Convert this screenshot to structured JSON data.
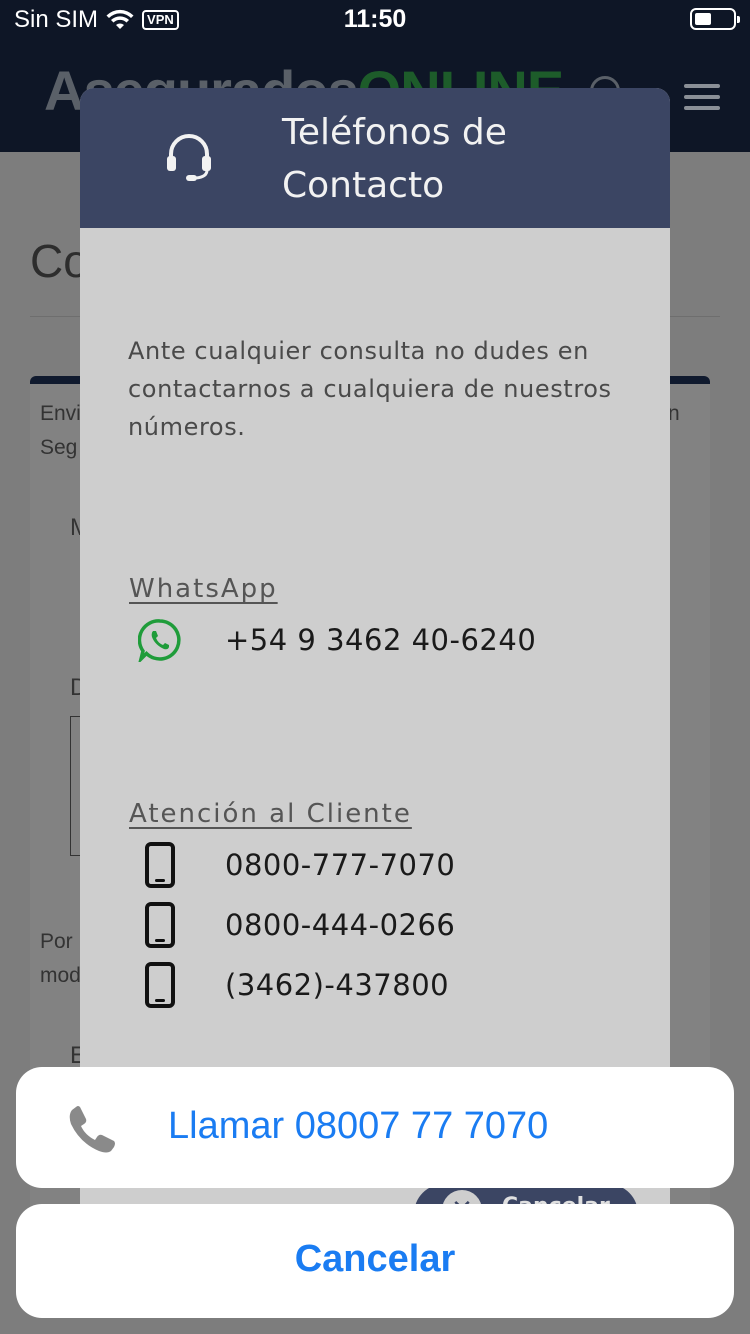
{
  "status_bar": {
    "carrier": "Sin SIM",
    "vpn": "VPN",
    "time": "11:50"
  },
  "background_page": {
    "logo_part1": "Asegurados",
    "logo_part2": "ONLINE",
    "title_partial": "Co",
    "text_1": "Envi",
    "text_2": "Seg",
    "text_3": "n",
    "text_4": "M",
    "text_5": "D",
    "text_6": "Por",
    "text_7": "mod",
    "text_8": "E"
  },
  "modal": {
    "title": "Teléfonos de Contacto",
    "intro": "Ante cualquier consulta no dudes en contactarnos a cualquiera de nuestros números.",
    "whatsapp_label": "WhatsApp",
    "whatsapp_number": "+54 9 3462 40-6240",
    "customer_service_label": "Atención al Cliente",
    "phones": [
      "0800-777-7070",
      "0800-444-0266",
      "(3462)-437800"
    ],
    "cancel_button_partial": "Cancelar"
  },
  "action_sheet": {
    "call_label": "Llamar 08007 77 7070",
    "cancel_label": "Cancelar",
    "accent_color": "#1a7cf2"
  }
}
